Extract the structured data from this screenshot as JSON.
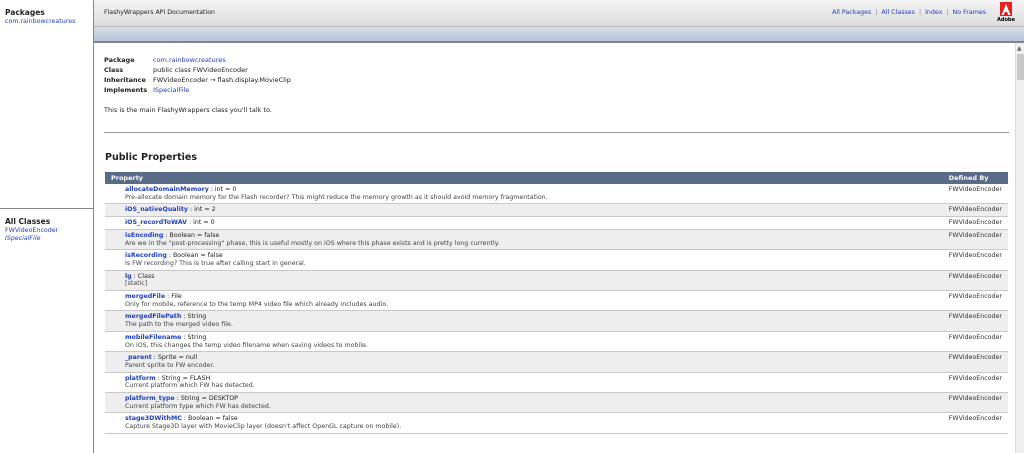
{
  "left": {
    "packages_title": "Packages",
    "package_link": "com.rainbowcreatures",
    "classes_title": "All Classes",
    "class_links": [
      "FWVideoEncoder",
      "ISpecialFile"
    ]
  },
  "header": {
    "title": "FlashyWrappers API Documentation",
    "nav": [
      "All Packages",
      "All Classes",
      "Index",
      "No Frames"
    ],
    "logo_text": "Adobe"
  },
  "meta": {
    "package_label": "Package",
    "package_value": "com.rainbowcreatures",
    "class_label": "Class",
    "class_value": "public class FWVideoEncoder",
    "inheritance_label": "Inheritance",
    "inheritance_value": "FWVideoEncoder → flash.display.MovieClip",
    "implements_label": "Implements",
    "implements_value": "ISpecialFile",
    "description": "This is the main FlashyWrappers class you'll talk to."
  },
  "properties": {
    "section_title": "Public Properties",
    "col_property": "Property",
    "col_defined_by": "Defined By",
    "rows": [
      {
        "name": "allocateDomainMemory",
        "sig": " : int = 0",
        "desc": "Pre-allocate domain memory for the Flash recorder? This might reduce the memory growth as it should avoid memory fragmentation.",
        "def": "FWVideoEncoder"
      },
      {
        "name": "iOS_nativeQuality",
        "sig": " : int = 2",
        "desc": "",
        "def": "FWVideoEncoder"
      },
      {
        "name": "iOS_recordToWAV",
        "sig": " : int = 0",
        "desc": "",
        "def": "FWVideoEncoder"
      },
      {
        "name": "isEncoding",
        "sig": " : Boolean = false",
        "desc": "Are we in the \"post-processing\" phase, this is useful mostly on iOS where this phase exists and is pretty long currently.",
        "def": "FWVideoEncoder"
      },
      {
        "name": "isRecording",
        "sig": " : Boolean = false",
        "desc": "Is FW recording? This is true after calling start in general.",
        "def": "FWVideoEncoder"
      },
      {
        "name": "lg",
        "sig": " : Class",
        "desc": "[static]",
        "def": "FWVideoEncoder"
      },
      {
        "name": "mergedFile",
        "sig": " : File",
        "desc": "Only for mobile, reference to the temp MP4 video file which already includes audio.",
        "def": "FWVideoEncoder"
      },
      {
        "name": "mergedFilePath",
        "sig": " : String",
        "desc": "The path to the merged video file.",
        "def": "FWVideoEncoder"
      },
      {
        "name": "mobileFilename",
        "sig": " : String",
        "desc": "On iOS, this changes the temp video filename when saving videos to mobile.",
        "def": "FWVideoEncoder"
      },
      {
        "name": "_parent",
        "sig": " : Sprite = null",
        "desc": "Parent sprite to FW encoder.",
        "def": "FWVideoEncoder"
      },
      {
        "name": "platform",
        "sig": " : String = FLASH",
        "desc": "Current platform which FW has detected.",
        "def": "FWVideoEncoder"
      },
      {
        "name": "platform_type",
        "sig": " : String = DESKTOP",
        "desc": "Current platform type which FW has detected.",
        "def": "FWVideoEncoder"
      },
      {
        "name": "stage3DWithMC",
        "sig": " : Boolean = false",
        "desc": "Capture Stage3D layer with MovieClip layer (doesn't affect OpenGL capture on mobile).",
        "def": "FWVideoEncoder"
      }
    ]
  }
}
